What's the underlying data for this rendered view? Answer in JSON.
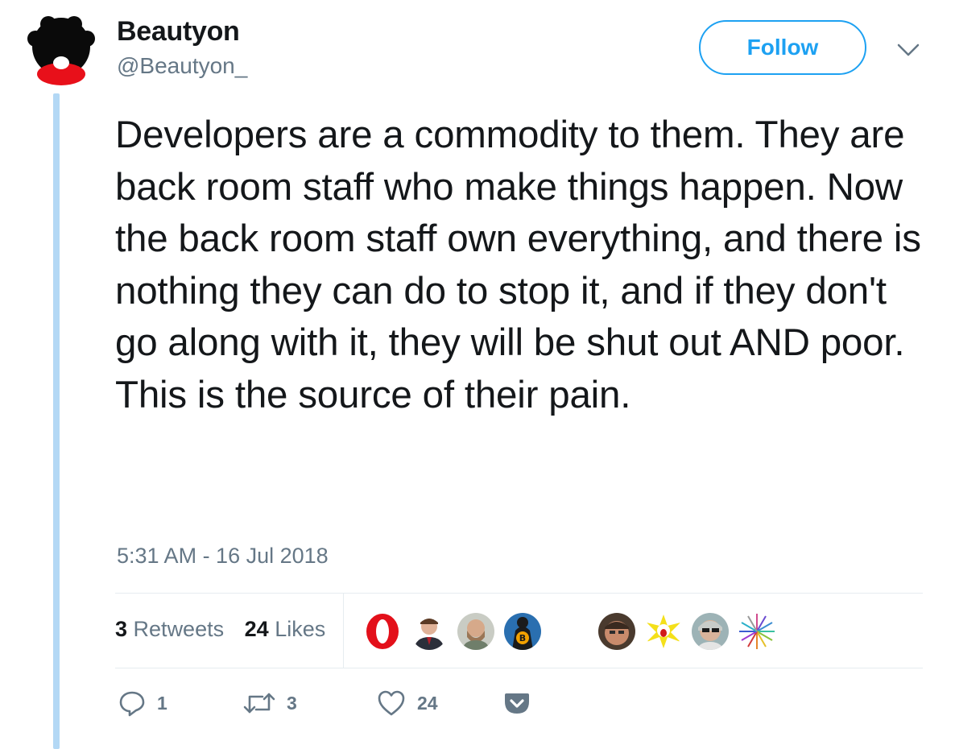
{
  "author": {
    "display_name": "Beautyon",
    "handle": "@Beautyon_"
  },
  "follow_button": {
    "label": "Follow"
  },
  "tweet": {
    "text": "Developers are a commodity to them. They are back room staff who make things happen. Now the back room staff own everything, and there is nothing they can do to stop it, and if they don't go along with it, they will be shut out AND poor. This is the source of their pain.",
    "timestamp": "5:31 AM - 16 Jul 2018"
  },
  "stats": {
    "retweets_count": "3",
    "retweets_label": "Retweets",
    "likes_count": "24",
    "likes_label": "Likes"
  },
  "actions": {
    "reply_count": "1",
    "retweet_count": "3",
    "like_count": "24"
  },
  "colors": {
    "accent": "#1da1f2",
    "thread_line": "#b3d8f5",
    "secondary_text": "#657786"
  }
}
